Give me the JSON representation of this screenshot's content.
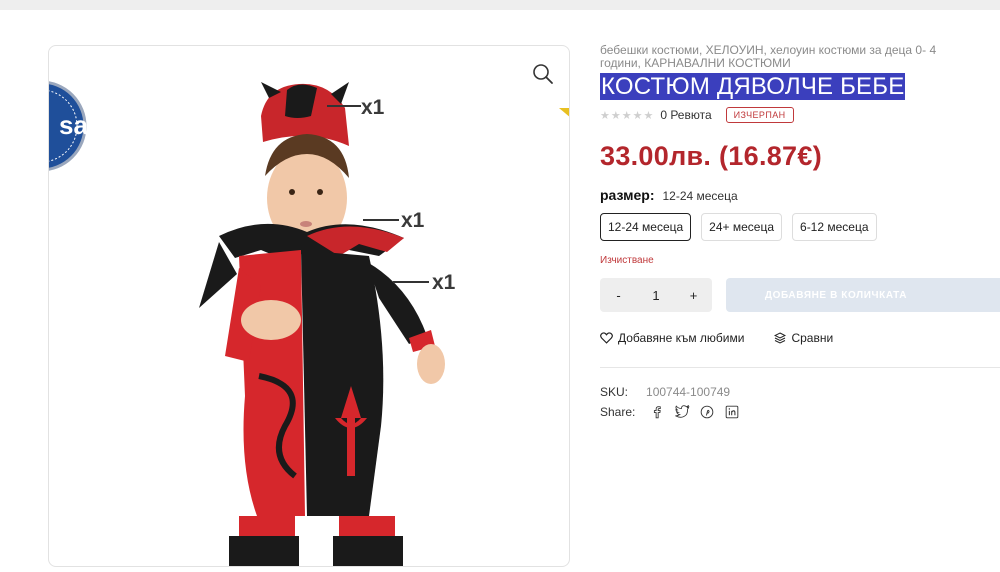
{
  "product": {
    "categories": "бебешки костюми, ХЕЛОУИН, хелоуин костюми за деца 0- 4 години, КАРНАВАЛНИ КОСТЮМИ",
    "title": "КОСТЮМ ДЯВОЛЧЕ БЕБЕ",
    "reviews_label": "0 Ревюта",
    "rating_stars": 0,
    "stock_badge": "ИЗЧЕРПАН",
    "price": "33.00лв. (16.87€)",
    "accent_color": "#b3262c",
    "selection_color": "#3b3fbd"
  },
  "gallery": {
    "zoom_icon": "magnifier-icon",
    "image_labels": [
      "x1",
      "x1",
      "x1"
    ],
    "badge_text": "sa"
  },
  "size": {
    "label": "размер:",
    "selected_value": "12-24 месеца",
    "options": [
      "12-24 месеца",
      "24+ месеца",
      "6-12 месеца"
    ],
    "clear_label": "Изчистване"
  },
  "quantity": {
    "minus": "-",
    "value": "1",
    "plus": "+"
  },
  "cart": {
    "add_label": "ДОБАВЯНЕ В КОЛИЧКАТА"
  },
  "actions": {
    "wishlist_label": "Добавяне към любими",
    "wishlist_icon": "heart-icon",
    "compare_label": "Сравни",
    "compare_icon": "layers-icon"
  },
  "meta": {
    "sku_label": "SKU:",
    "sku_value": "100744-100749",
    "share_label": "Share:",
    "share_icons": [
      "facebook-icon",
      "twitter-icon",
      "pinterest-icon",
      "linkedin-icon"
    ]
  }
}
